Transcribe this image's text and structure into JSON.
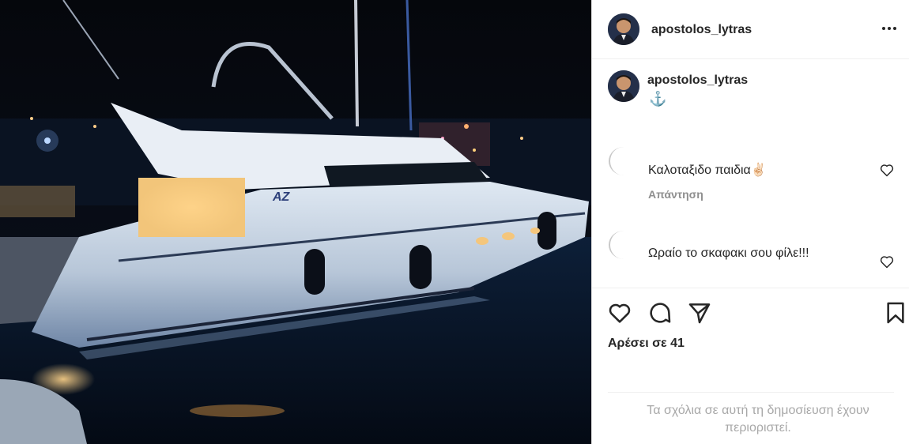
{
  "post": {
    "photo_alt": "boat-photo",
    "boat_logo": "AZ"
  },
  "header": {
    "username": "apostolos_lytras",
    "more_icon": "more-horizontal-icon"
  },
  "caption": {
    "username": "apostolos_lytras",
    "text": "⚓"
  },
  "comments": [
    {
      "text": "Καλοταξιδο παιδια✌🏻",
      "reply_label": "Απάντηση"
    },
    {
      "text": "Ωραίο το σκαφακι σου φίλε!!!"
    }
  ],
  "actions": {
    "icons": [
      "heart-icon",
      "comment-icon",
      "share-icon",
      "bookmark-icon"
    ]
  },
  "likes": "Αρέσει σε 41",
  "comments_restricted": "Τα σχόλια σε αυτή τη δημοσίευση έχουν περιοριστεί.",
  "colors": {
    "anchor": "#3a8ed9",
    "muted": "#8e8e8e",
    "restricted_text": "#a8a8a8"
  }
}
